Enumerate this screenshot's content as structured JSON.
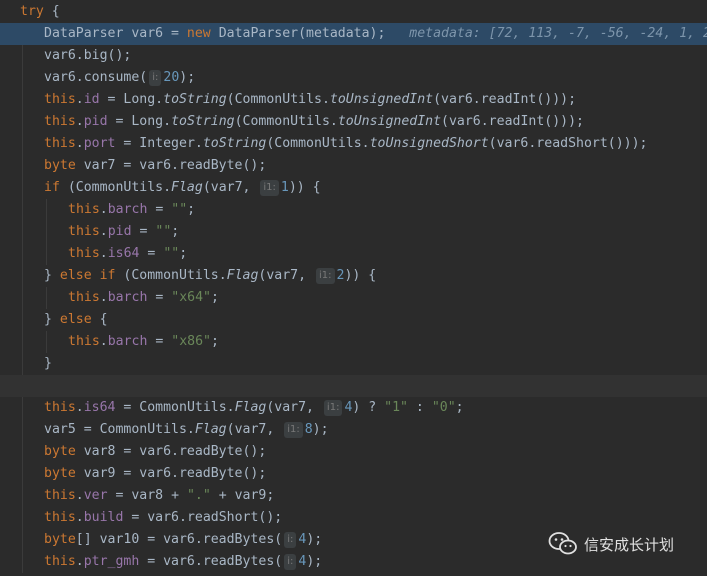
{
  "lines": [
    {
      "indent": 0,
      "tokens": [
        {
          "t": "kw",
          "v": "try"
        },
        {
          "t": "txt",
          "v": " {"
        }
      ]
    },
    {
      "indent": 1,
      "highlight": true,
      "tokens": [
        {
          "t": "txt",
          "v": "DataParser var6 = "
        },
        {
          "t": "kw",
          "v": "new "
        },
        {
          "t": "txt",
          "v": "DataParser(metadata);   "
        },
        {
          "t": "dbg",
          "v": "metadata: [72, 113, -7, -56, -24, 1, 2"
        }
      ]
    },
    {
      "indent": 1,
      "tokens": [
        {
          "t": "txt",
          "v": "var6.big();"
        }
      ]
    },
    {
      "indent": 1,
      "tokens": [
        {
          "t": "txt",
          "v": "var6.consume("
        },
        {
          "t": "hint",
          "v": "i:"
        },
        {
          "t": "num",
          "v": "20"
        },
        {
          "t": "txt",
          "v": ");"
        }
      ]
    },
    {
      "indent": 1,
      "tokens": [
        {
          "t": "kw",
          "v": "this"
        },
        {
          "t": "txt",
          "v": "."
        },
        {
          "t": "fld",
          "v": "id"
        },
        {
          "t": "txt",
          "v": " = Long."
        },
        {
          "t": "sm",
          "v": "toString"
        },
        {
          "t": "txt",
          "v": "(CommonUtils."
        },
        {
          "t": "sm",
          "v": "toUnsignedInt"
        },
        {
          "t": "txt",
          "v": "(var6.readInt()));"
        }
      ]
    },
    {
      "indent": 1,
      "tokens": [
        {
          "t": "kw",
          "v": "this"
        },
        {
          "t": "txt",
          "v": "."
        },
        {
          "t": "fld",
          "v": "pid"
        },
        {
          "t": "txt",
          "v": " = Long."
        },
        {
          "t": "sm",
          "v": "toString"
        },
        {
          "t": "txt",
          "v": "(CommonUtils."
        },
        {
          "t": "sm",
          "v": "toUnsignedInt"
        },
        {
          "t": "txt",
          "v": "(var6.readInt()));"
        }
      ]
    },
    {
      "indent": 1,
      "tokens": [
        {
          "t": "kw",
          "v": "this"
        },
        {
          "t": "txt",
          "v": "."
        },
        {
          "t": "fld",
          "v": "port"
        },
        {
          "t": "txt",
          "v": " = Integer."
        },
        {
          "t": "sm",
          "v": "toString"
        },
        {
          "t": "txt",
          "v": "(CommonUtils."
        },
        {
          "t": "sm",
          "v": "toUnsignedShort"
        },
        {
          "t": "txt",
          "v": "(var6.readShort()));"
        }
      ]
    },
    {
      "indent": 1,
      "tokens": [
        {
          "t": "kw",
          "v": "byte "
        },
        {
          "t": "txt",
          "v": "var7 = var6.readByte();"
        }
      ]
    },
    {
      "indent": 1,
      "tokens": [
        {
          "t": "kw",
          "v": "if "
        },
        {
          "t": "txt",
          "v": "(CommonUtils."
        },
        {
          "t": "sm",
          "v": "Flag"
        },
        {
          "t": "txt",
          "v": "(var7, "
        },
        {
          "t": "hint",
          "v": "i1:"
        },
        {
          "t": "num",
          "v": "1"
        },
        {
          "t": "txt",
          "v": ")) {"
        }
      ]
    },
    {
      "indent": 2,
      "tokens": [
        {
          "t": "kw",
          "v": "this"
        },
        {
          "t": "txt",
          "v": "."
        },
        {
          "t": "fld",
          "v": "barch"
        },
        {
          "t": "txt",
          "v": " = "
        },
        {
          "t": "str",
          "v": "\"\""
        },
        {
          "t": "txt",
          "v": ";"
        }
      ]
    },
    {
      "indent": 2,
      "tokens": [
        {
          "t": "kw",
          "v": "this"
        },
        {
          "t": "txt",
          "v": "."
        },
        {
          "t": "fld",
          "v": "pid"
        },
        {
          "t": "txt",
          "v": " = "
        },
        {
          "t": "str",
          "v": "\"\""
        },
        {
          "t": "txt",
          "v": ";"
        }
      ]
    },
    {
      "indent": 2,
      "tokens": [
        {
          "t": "kw",
          "v": "this"
        },
        {
          "t": "txt",
          "v": "."
        },
        {
          "t": "fld",
          "v": "is64"
        },
        {
          "t": "txt",
          "v": " = "
        },
        {
          "t": "str",
          "v": "\"\""
        },
        {
          "t": "txt",
          "v": ";"
        }
      ]
    },
    {
      "indent": 1,
      "tokens": [
        {
          "t": "txt",
          "v": "} "
        },
        {
          "t": "kw",
          "v": "else if "
        },
        {
          "t": "txt",
          "v": "(CommonUtils."
        },
        {
          "t": "sm",
          "v": "Flag"
        },
        {
          "t": "txt",
          "v": "(var7, "
        },
        {
          "t": "hint",
          "v": "i1:"
        },
        {
          "t": "num",
          "v": "2"
        },
        {
          "t": "txt",
          "v": ")) {"
        }
      ]
    },
    {
      "indent": 2,
      "tokens": [
        {
          "t": "kw",
          "v": "this"
        },
        {
          "t": "txt",
          "v": "."
        },
        {
          "t": "fld",
          "v": "barch"
        },
        {
          "t": "txt",
          "v": " = "
        },
        {
          "t": "str",
          "v": "\"x64\""
        },
        {
          "t": "txt",
          "v": ";"
        }
      ]
    },
    {
      "indent": 1,
      "tokens": [
        {
          "t": "txt",
          "v": "} "
        },
        {
          "t": "kw",
          "v": "else "
        },
        {
          "t": "txt",
          "v": "{"
        }
      ]
    },
    {
      "indent": 2,
      "tokens": [
        {
          "t": "kw",
          "v": "this"
        },
        {
          "t": "txt",
          "v": "."
        },
        {
          "t": "fld",
          "v": "barch"
        },
        {
          "t": "txt",
          "v": " = "
        },
        {
          "t": "str",
          "v": "\"x86\""
        },
        {
          "t": "txt",
          "v": ";"
        }
      ]
    },
    {
      "indent": 1,
      "tokens": [
        {
          "t": "txt",
          "v": "}"
        }
      ]
    },
    {
      "indent": 0,
      "blank": true,
      "tokens": []
    },
    {
      "indent": 1,
      "tokens": [
        {
          "t": "kw",
          "v": "this"
        },
        {
          "t": "txt",
          "v": "."
        },
        {
          "t": "fld",
          "v": "is64"
        },
        {
          "t": "txt",
          "v": " = CommonUtils."
        },
        {
          "t": "sm",
          "v": "Flag"
        },
        {
          "t": "txt",
          "v": "(var7, "
        },
        {
          "t": "hint",
          "v": "i1:"
        },
        {
          "t": "num",
          "v": "4"
        },
        {
          "t": "txt",
          "v": ") ? "
        },
        {
          "t": "str",
          "v": "\"1\""
        },
        {
          "t": "txt",
          "v": " : "
        },
        {
          "t": "str",
          "v": "\"0\""
        },
        {
          "t": "txt",
          "v": ";"
        }
      ]
    },
    {
      "indent": 1,
      "tokens": [
        {
          "t": "txt",
          "v": "var5 = CommonUtils."
        },
        {
          "t": "sm",
          "v": "Flag"
        },
        {
          "t": "txt",
          "v": "(var7, "
        },
        {
          "t": "hint",
          "v": "i1:"
        },
        {
          "t": "num",
          "v": "8"
        },
        {
          "t": "txt",
          "v": ");"
        }
      ]
    },
    {
      "indent": 1,
      "tokens": [
        {
          "t": "kw",
          "v": "byte "
        },
        {
          "t": "txt",
          "v": "var8 = var6.readByte();"
        }
      ]
    },
    {
      "indent": 1,
      "tokens": [
        {
          "t": "kw",
          "v": "byte "
        },
        {
          "t": "txt",
          "v": "var9 = var6.readByte();"
        }
      ]
    },
    {
      "indent": 1,
      "tokens": [
        {
          "t": "kw",
          "v": "this"
        },
        {
          "t": "txt",
          "v": "."
        },
        {
          "t": "fld",
          "v": "ver"
        },
        {
          "t": "txt",
          "v": " = var8 + "
        },
        {
          "t": "str",
          "v": "\".\""
        },
        {
          "t": "txt",
          "v": " + var9;"
        }
      ]
    },
    {
      "indent": 1,
      "tokens": [
        {
          "t": "kw",
          "v": "this"
        },
        {
          "t": "txt",
          "v": "."
        },
        {
          "t": "fld",
          "v": "build"
        },
        {
          "t": "txt",
          "v": " = var6.readShort();"
        }
      ]
    },
    {
      "indent": 1,
      "tokens": [
        {
          "t": "kw",
          "v": "byte"
        },
        {
          "t": "txt",
          "v": "[] var10 = var6.readBytes("
        },
        {
          "t": "hint",
          "v": "i:"
        },
        {
          "t": "num",
          "v": "4"
        },
        {
          "t": "txt",
          "v": ");"
        }
      ]
    },
    {
      "indent": 1,
      "tokens": [
        {
          "t": "kw",
          "v": "this"
        },
        {
          "t": "txt",
          "v": "."
        },
        {
          "t": "fld",
          "v": "ptr_gmh"
        },
        {
          "t": "txt",
          "v": " = var6.readBytes("
        },
        {
          "t": "hint",
          "v": "i:"
        },
        {
          "t": "num",
          "v": "4"
        },
        {
          "t": "txt",
          "v": ");"
        }
      ]
    }
  ],
  "watermark": {
    "text": "信安成长计划",
    "icon": "wechat-icon"
  },
  "colors": {
    "background": "#2b2b2b",
    "highlight": "#2d4a66",
    "keyword": "#cc7832",
    "field": "#9876aa",
    "number": "#6897bb",
    "string": "#6a8759",
    "text": "#a9b7c6"
  }
}
